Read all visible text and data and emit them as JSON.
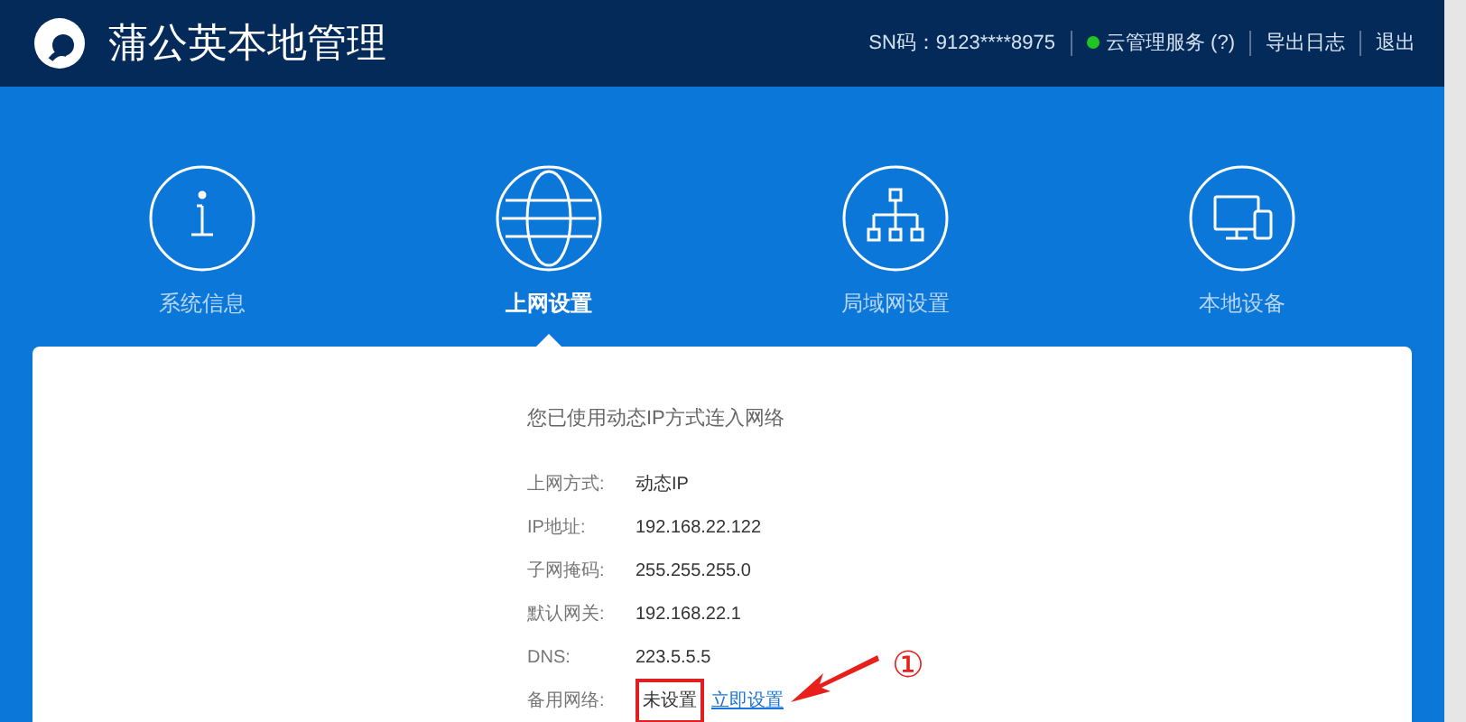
{
  "header": {
    "title": "蒲公英本地管理",
    "sn": "SN码：9123****8975",
    "cloud_service": {
      "label": "云管理服务 (?)",
      "online": true
    },
    "links": [
      "导出日志",
      "退出"
    ]
  },
  "nav": [
    {
      "kind": "info",
      "label": "系统信息",
      "selected": false
    },
    {
      "kind": "globe",
      "label": "上网设置",
      "selected": true
    },
    {
      "kind": "network",
      "label": "局域网设置",
      "selected": false
    },
    {
      "kind": "devices",
      "label": "本地设备",
      "selected": false
    }
  ],
  "panel": {
    "heading": "您已使用动态IP方式连入网络",
    "rows": [
      {
        "label": "上网方式:",
        "value": "动态IP"
      },
      {
        "label": "IP地址:",
        "value": "192.168.22.122"
      },
      {
        "label": "子网掩码:",
        "value": "255.255.255.0"
      },
      {
        "label": "默认网关:",
        "value": "192.168.22.1"
      },
      {
        "label": "DNS:",
        "value": "223.5.5.5"
      },
      {
        "label": "备用网络:",
        "value": "未设置",
        "highlighted": true,
        "link": "立即设置"
      }
    ]
  },
  "annotation": {
    "marker": "①"
  }
}
